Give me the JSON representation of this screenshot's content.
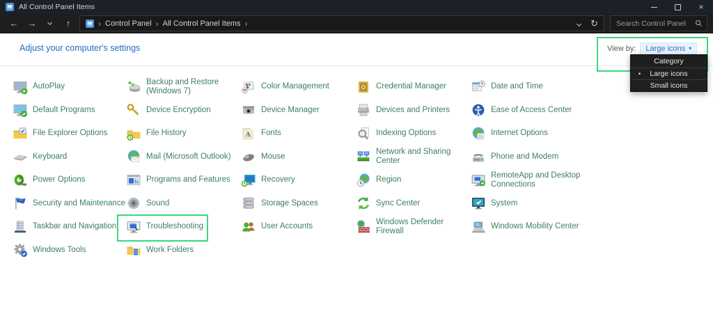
{
  "window": {
    "title": "All Control Panel Items"
  },
  "navbar": {
    "breadcrumb": {
      "items": [
        "Control Panel",
        "All Control Panel Items"
      ]
    },
    "search": {
      "placeholder": "Search Control Panel"
    }
  },
  "content": {
    "heading": "Adjust your computer's settings",
    "view_by": {
      "label": "View by:",
      "value": "Large icons"
    }
  },
  "view_dropdown": {
    "options": [
      "Category",
      "Large icons",
      "Small icons"
    ],
    "selected": "Large icons"
  },
  "columns": [
    {
      "items": [
        {
          "label": "AutoPlay",
          "icon": "autoplay-icon"
        },
        {
          "label": "Default Programs",
          "icon": "default-programs-icon"
        },
        {
          "label": "File Explorer Options",
          "icon": "file-explorer-options-icon"
        },
        {
          "label": "Keyboard",
          "icon": "keyboard-icon"
        },
        {
          "label": "Power Options",
          "icon": "power-options-icon"
        },
        {
          "label": "Security and Maintenance",
          "icon": "security-maintenance-icon"
        },
        {
          "label": "Taskbar and Navigation",
          "icon": "taskbar-icon"
        },
        {
          "label": "Windows Tools",
          "icon": "windows-tools-icon"
        }
      ]
    },
    {
      "items": [
        {
          "label": "Backup and Restore (Windows 7)",
          "icon": "backup-restore-icon"
        },
        {
          "label": "Device Encryption",
          "icon": "device-encryption-icon"
        },
        {
          "label": "File History",
          "icon": "file-history-icon"
        },
        {
          "label": "Mail (Microsoft Outlook)",
          "icon": "mail-icon"
        },
        {
          "label": "Programs and Features",
          "icon": "programs-features-icon"
        },
        {
          "label": "Sound",
          "icon": "sound-icon"
        },
        {
          "label": "Troubleshooting",
          "icon": "troubleshooting-icon",
          "highlighted": true
        },
        {
          "label": "Work Folders",
          "icon": "work-folders-icon"
        }
      ]
    },
    {
      "items": [
        {
          "label": "Color Management",
          "icon": "color-management-icon"
        },
        {
          "label": "Device Manager",
          "icon": "device-manager-icon"
        },
        {
          "label": "Fonts",
          "icon": "fonts-icon"
        },
        {
          "label": "Mouse",
          "icon": "mouse-icon"
        },
        {
          "label": "Recovery",
          "icon": "recovery-icon"
        },
        {
          "label": "Storage Spaces",
          "icon": "storage-spaces-icon"
        },
        {
          "label": "User Accounts",
          "icon": "user-accounts-icon"
        }
      ]
    },
    {
      "items": [
        {
          "label": "Credential Manager",
          "icon": "credential-manager-icon"
        },
        {
          "label": "Devices and Printers",
          "icon": "devices-printers-icon"
        },
        {
          "label": "Indexing Options",
          "icon": "indexing-options-icon"
        },
        {
          "label": "Network and Sharing Center",
          "icon": "network-sharing-icon"
        },
        {
          "label": "Region",
          "icon": "region-icon"
        },
        {
          "label": "Sync Center",
          "icon": "sync-center-icon"
        },
        {
          "label": "Windows Defender Firewall",
          "icon": "firewall-icon"
        }
      ]
    },
    {
      "items": [
        {
          "label": "Date and Time",
          "icon": "date-time-icon"
        },
        {
          "label": "Ease of Access Center",
          "icon": "ease-of-access-icon"
        },
        {
          "label": "Internet Options",
          "icon": "internet-options-icon"
        },
        {
          "label": "Phone and Modem",
          "icon": "phone-modem-icon"
        },
        {
          "label": "RemoteApp and Desktop Connections",
          "icon": "remoteapp-icon"
        },
        {
          "label": "System",
          "icon": "system-icon"
        },
        {
          "label": "Windows Mobility Center",
          "icon": "mobility-center-icon"
        }
      ]
    }
  ],
  "colors": {
    "highlight_green": "#3bd67f",
    "item_link_green": "#3e7e60",
    "heading_blue": "#1f6bc4",
    "viewby_blue": "#2f73c9"
  }
}
